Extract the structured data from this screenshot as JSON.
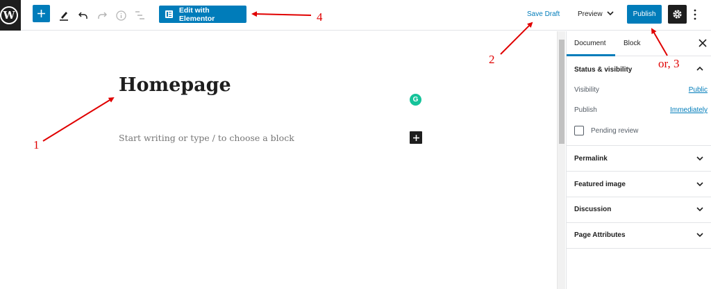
{
  "toolbar": {
    "wp_logo": "wordpress-logo",
    "add_block_icon": "plus-icon",
    "tools_icon": "pencil-icon",
    "undo_icon": "undo-icon",
    "redo_icon": "redo-icon",
    "info_icon": "info-icon",
    "outline_icon": "list-view-icon",
    "elementor_label": "Edit with Elementor",
    "save_draft_label": "Save Draft",
    "preview_label": "Preview",
    "publish_label": "Publish",
    "settings_icon": "gear-icon",
    "more_icon": "more-vertical-icon"
  },
  "editor": {
    "title": "Homepage",
    "placeholder": "Start writing or type / to choose a block",
    "grammarly_glyph": "G"
  },
  "sidebar": {
    "tabs": [
      {
        "label": "Document",
        "active": true
      },
      {
        "label": "Block",
        "active": false
      }
    ],
    "status_visibility": {
      "title": "Status & visibility",
      "visibility_label": "Visibility",
      "visibility_value": "Public",
      "publish_label": "Publish",
      "publish_value": "Immediately",
      "pending_review_label": "Pending review"
    },
    "panels": [
      {
        "title": "Permalink"
      },
      {
        "title": "Featured image"
      },
      {
        "title": "Discussion"
      },
      {
        "title": "Page Attributes"
      }
    ]
  },
  "annotations": {
    "one": "1",
    "two": "2",
    "three": "or, 3",
    "four": "4"
  },
  "colors": {
    "accent": "#007cba",
    "annotation": "#e00000",
    "dark": "#1e1e1e",
    "grammarly": "#15c39a"
  }
}
